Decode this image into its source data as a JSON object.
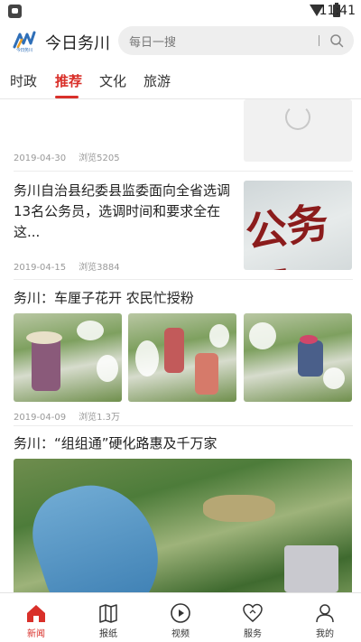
{
  "status_bar": {
    "time": "11:41"
  },
  "header": {
    "app_title": "今日务川",
    "logo_caption": "今日务川",
    "search_placeholder": "每日一搜"
  },
  "tabs": [
    {
      "label": "时政",
      "active": false
    },
    {
      "label": "推荐",
      "active": true
    },
    {
      "label": "文化",
      "active": false
    },
    {
      "label": "旅游",
      "active": false
    }
  ],
  "feed": [
    {
      "date": "2019-04-30",
      "views": "浏览5205"
    },
    {
      "title": "务川自治县纪委县监委面向全省选调13名公务员，选调时间和要求全在这...",
      "image_text": "公务员",
      "date": "2019-04-15",
      "views": "浏览3884"
    },
    {
      "title": "务川：车厘子花开 农民忙授粉",
      "date": "2019-04-09",
      "views": "浏览1.3万"
    },
    {
      "title": "务川：“组组通”硬化路惠及千万家"
    }
  ],
  "bottom_nav": [
    {
      "label": "新闻",
      "icon": "home-icon",
      "active": true
    },
    {
      "label": "报纸",
      "icon": "newspaper-icon",
      "active": false
    },
    {
      "label": "视频",
      "icon": "play-circle-icon",
      "active": false
    },
    {
      "label": "服务",
      "icon": "heart-service-icon",
      "active": false
    },
    {
      "label": "我的",
      "icon": "user-icon",
      "active": false
    }
  ],
  "colors": {
    "accent": "#d9302a",
    "logo_blue": "#2f6fb8"
  }
}
